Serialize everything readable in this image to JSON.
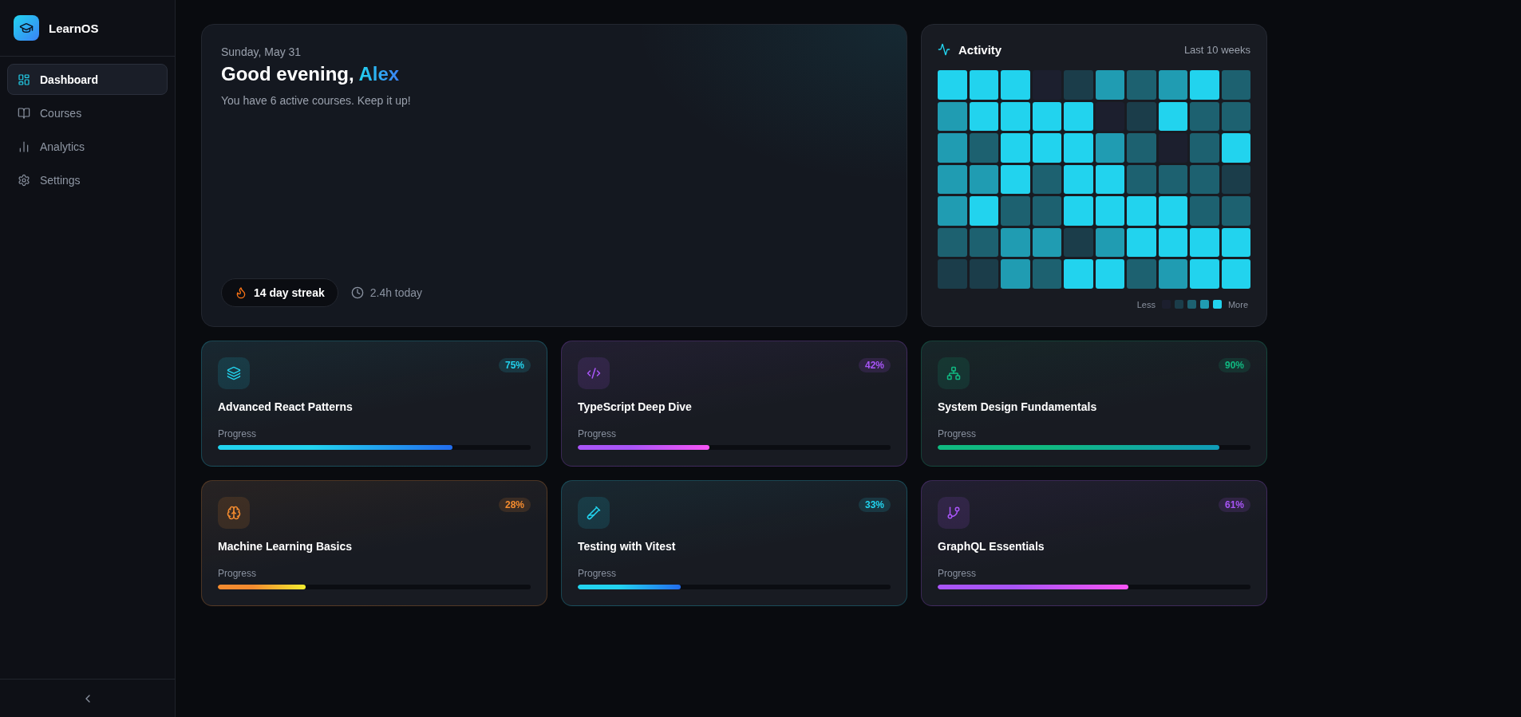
{
  "sidebar": {
    "brand": "LearnOS",
    "nav": [
      {
        "label": "Dashboard",
        "selected": true
      },
      {
        "label": "Courses",
        "selected": false
      },
      {
        "label": "Analytics",
        "selected": false
      },
      {
        "label": "Settings",
        "selected": false
      }
    ]
  },
  "hero": {
    "date": "Sunday, May 31",
    "greeting": "Good evening,",
    "name": "Alex",
    "subtitle": "You have 6 active courses. Keep it up!",
    "streak": "14 day streak",
    "time_today": "2.4h today"
  },
  "activity": {
    "title": "Activity",
    "range": "Last 10 weeks",
    "weeks": [
      {
        "days": [
          {
            "color": "#22d3ee"
          },
          {
            "color": "#209cb2"
          },
          {
            "color": "#209cb2"
          },
          {
            "color": "#209cb2"
          },
          {
            "color": "#209cb2"
          },
          {
            "color": "#1d6170"
          },
          {
            "color": "#1b3d4a"
          }
        ]
      },
      {
        "days": [
          {
            "color": "#22d3ee"
          },
          {
            "color": "#22d3ee"
          },
          {
            "color": "#1d6170"
          },
          {
            "color": "#209cb2"
          },
          {
            "color": "#22d3ee"
          },
          {
            "color": "#1d6170"
          },
          {
            "color": "#1b3d4a"
          }
        ]
      },
      {
        "days": [
          {
            "color": "#22d3ee"
          },
          {
            "color": "#22d3ee"
          },
          {
            "color": "#22d3ee"
          },
          {
            "color": "#22d3ee"
          },
          {
            "color": "#1d6170"
          },
          {
            "color": "#209cb2"
          },
          {
            "color": "#209cb2"
          }
        ]
      },
      {
        "days": [
          {
            "color": "#1c1f2e"
          },
          {
            "color": "#22d3ee"
          },
          {
            "color": "#22d3ee"
          },
          {
            "color": "#1d6170"
          },
          {
            "color": "#1d6170"
          },
          {
            "color": "#209cb2"
          },
          {
            "color": "#1d6170"
          }
        ]
      },
      {
        "days": [
          {
            "color": "#1b3d4a"
          },
          {
            "color": "#22d3ee"
          },
          {
            "color": "#22d3ee"
          },
          {
            "color": "#22d3ee"
          },
          {
            "color": "#22d3ee"
          },
          {
            "color": "#1b3d4a"
          },
          {
            "color": "#22d3ee"
          }
        ]
      },
      {
        "days": [
          {
            "color": "#209cb2"
          },
          {
            "color": "#1c1f2e"
          },
          {
            "color": "#209cb2"
          },
          {
            "color": "#22d3ee"
          },
          {
            "color": "#22d3ee"
          },
          {
            "color": "#209cb2"
          },
          {
            "color": "#22d3ee"
          }
        ]
      },
      {
        "days": [
          {
            "color": "#1d6170"
          },
          {
            "color": "#1b3d4a"
          },
          {
            "color": "#1d6170"
          },
          {
            "color": "#1d6170"
          },
          {
            "color": "#22d3ee"
          },
          {
            "color": "#22d3ee"
          },
          {
            "color": "#1d6170"
          }
        ]
      },
      {
        "days": [
          {
            "color": "#209cb2"
          },
          {
            "color": "#22d3ee"
          },
          {
            "color": "#1c1f2e"
          },
          {
            "color": "#1d6170"
          },
          {
            "color": "#22d3ee"
          },
          {
            "color": "#22d3ee"
          },
          {
            "color": "#209cb2"
          }
        ]
      },
      {
        "days": [
          {
            "color": "#22d3ee"
          },
          {
            "color": "#1d6170"
          },
          {
            "color": "#1d6170"
          },
          {
            "color": "#1d6170"
          },
          {
            "color": "#1d6170"
          },
          {
            "color": "#22d3ee"
          },
          {
            "color": "#22d3ee"
          }
        ]
      },
      {
        "days": [
          {
            "color": "#1d6170"
          },
          {
            "color": "#1d6170"
          },
          {
            "color": "#22d3ee"
          },
          {
            "color": "#1b3d4a"
          },
          {
            "color": "#1d6170"
          },
          {
            "color": "#22d3ee"
          },
          {
            "color": "#22d3ee"
          }
        ]
      }
    ],
    "legend": {
      "low": "Less",
      "high": "More",
      "swatches": [
        {
          "color": "#1c1f2e"
        },
        {
          "color": "#1b3d4a"
        },
        {
          "color": "#1d6170"
        },
        {
          "color": "#209cb2"
        },
        {
          "color": "#22d3ee"
        }
      ]
    }
  },
  "courses": [
    {
      "title": "Advanced React Patterns",
      "percent": "75%",
      "progress_label": "Progress",
      "level": 0.75,
      "color": "#22d3ee"
    },
    {
      "title": "TypeScript Deep Dive",
      "percent": "42%",
      "progress_label": "Progress",
      "level": 0.42,
      "color": "#a855f7"
    },
    {
      "title": "System Design Fundamentals",
      "percent": "90%",
      "progress_label": "Progress",
      "level": 0.9,
      "color": "#10b981"
    },
    {
      "title": "Machine Learning Basics",
      "percent": "28%",
      "progress_label": "Progress",
      "level": 0.28,
      "color": "#f38b2f"
    },
    {
      "title": "Testing with Vitest",
      "percent": "33%",
      "progress_label": "Progress",
      "level": 0.33,
      "color": "#22d3ee"
    },
    {
      "title": "GraphQL Essentials",
      "percent": "61%",
      "progress_label": "Progress",
      "level": 0.61,
      "color": "#a855f7"
    }
  ]
}
